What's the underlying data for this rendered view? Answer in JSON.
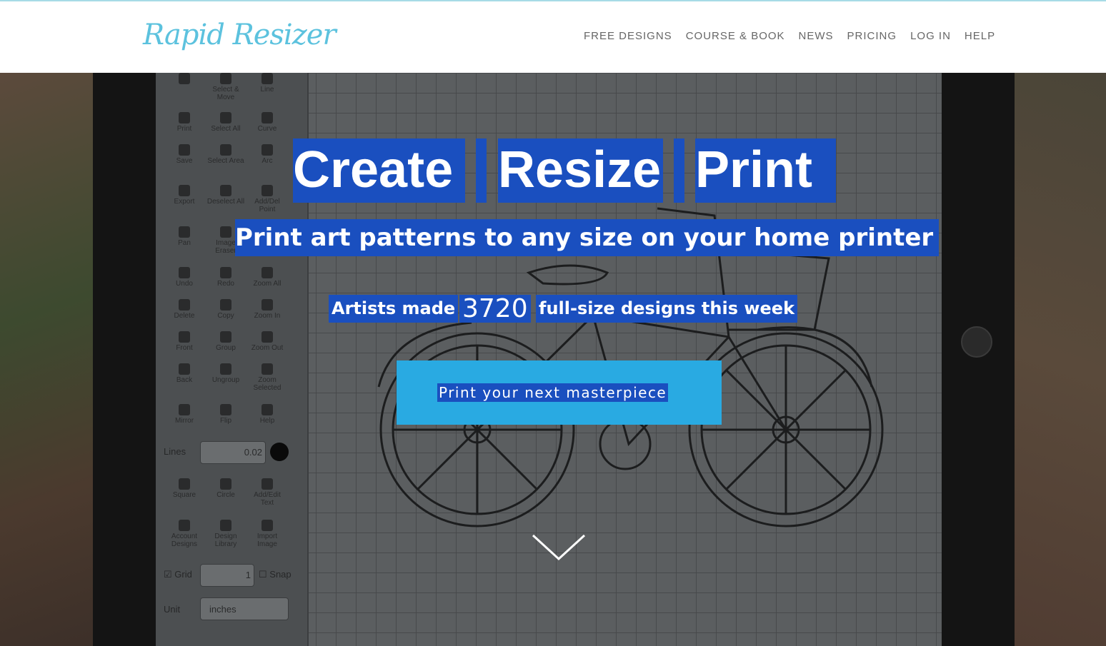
{
  "header": {
    "logo_text": "Rapid Resizer",
    "nav": [
      "FREE DESIGNS",
      "COURSE & BOOK",
      "NEWS",
      "PRICING",
      "LOG IN",
      "HELP"
    ]
  },
  "hero": {
    "title_words": [
      "Create",
      "Resize",
      "Print"
    ],
    "subtitle": "Print art patterns to any size on your home printer",
    "stat_prefix": "Artists made",
    "stat_number": "3720",
    "stat_suffix": "full-size designs this week",
    "cta_label": "Print your next masterpiece",
    "scroll_icon": "chevron-down-icon"
  },
  "background_app": {
    "tools": [
      "Select & Move",
      "Line",
      "Print",
      "Select All",
      "Curve",
      "Save",
      "Select Area",
      "Arc",
      "Export",
      "Deselect All",
      "Add/Del Point",
      "Pan",
      "Image Eraser",
      "Undo",
      "Redo",
      "Zoom All",
      "Delete",
      "Copy",
      "Zoom In",
      "Front",
      "Group",
      "Zoom Out",
      "Back",
      "Ungroup",
      "Zoom Selected",
      "Mirror",
      "Flip",
      "Help",
      "Square",
      "Circle",
      "Add/Edit Text",
      "Account Designs",
      "Design Library",
      "Import Image"
    ],
    "lines_label": "Lines",
    "lines_value": "0.02",
    "grid_label": "Grid",
    "grid_value": "1",
    "snap_label": "Snap",
    "unit_label": "Unit",
    "unit_value": "inches"
  },
  "colors": {
    "highlight": "#1a4fbf",
    "cta": "#29aae2",
    "logo": "#5cc2de"
  }
}
